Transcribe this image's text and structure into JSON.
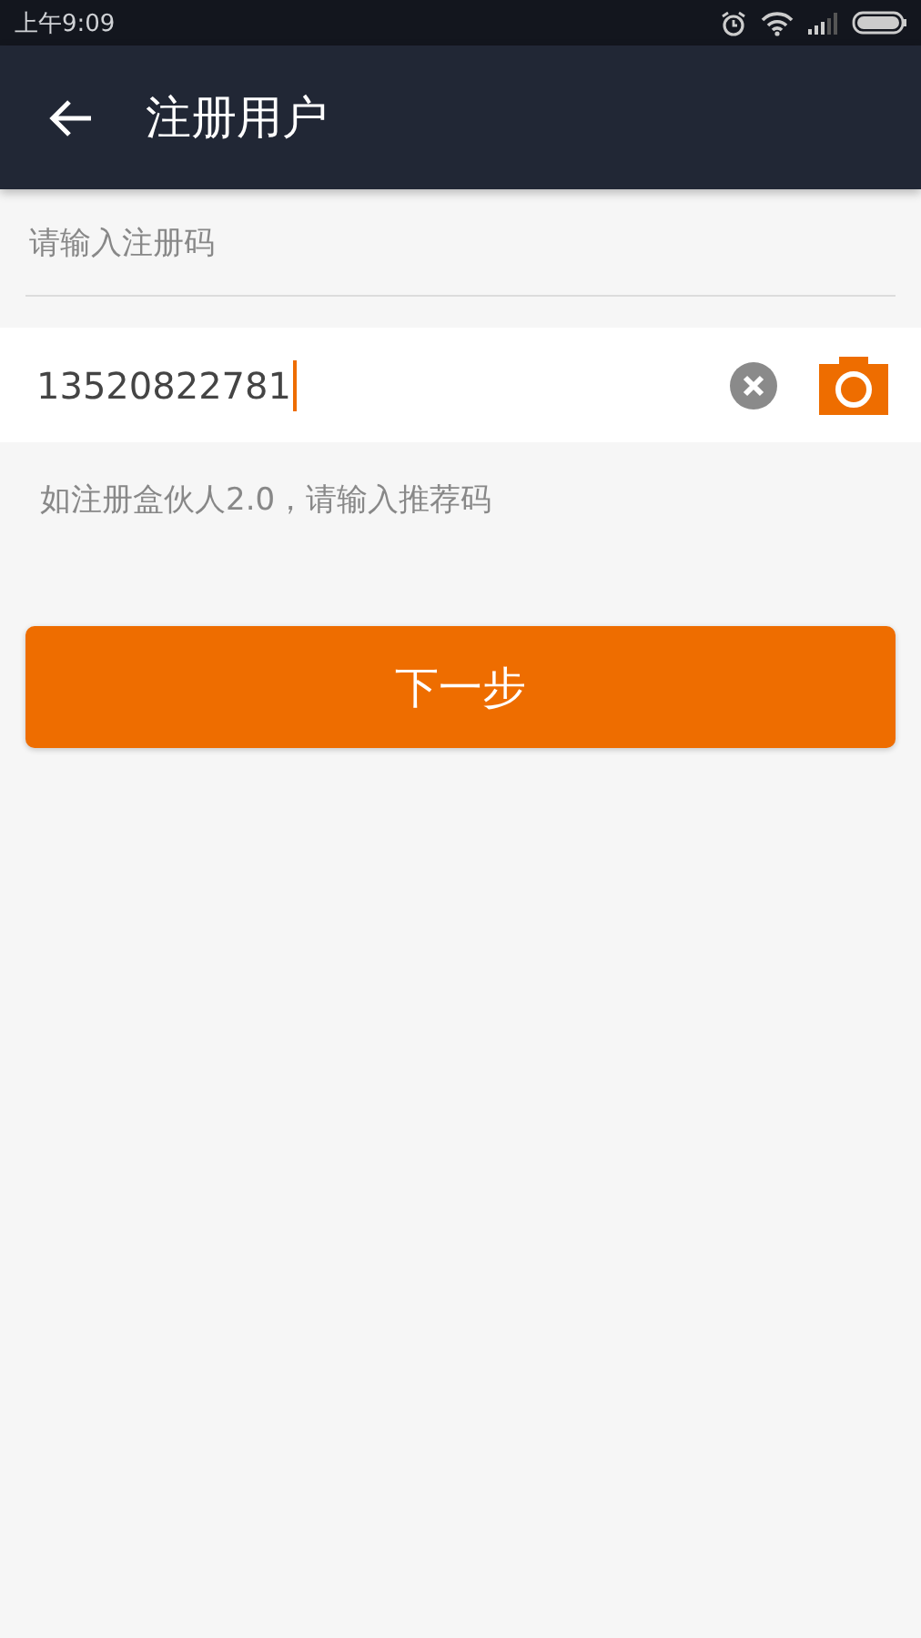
{
  "status_bar": {
    "time": "上午9:09"
  },
  "app_bar": {
    "title": "注册用户"
  },
  "form": {
    "label": "请输入注册码",
    "field": {
      "value": "13520822781",
      "focused": true
    },
    "hint": "如注册盒伙人2.0，请输入推荐码"
  },
  "buttons": [
    "下一步"
  ]
}
